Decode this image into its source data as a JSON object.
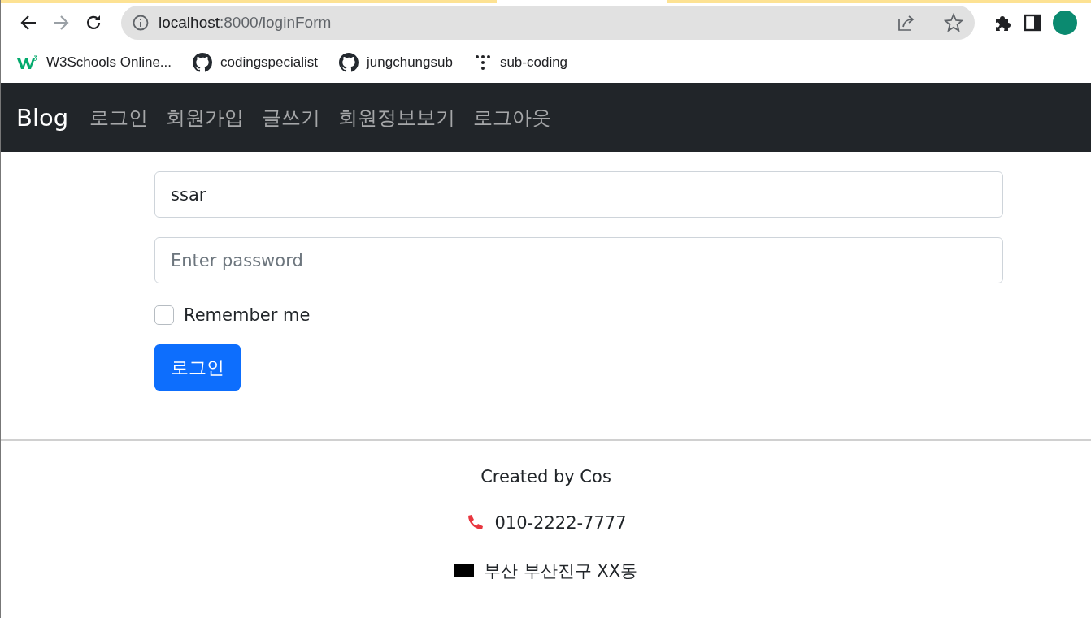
{
  "browser": {
    "url_host": "localhost",
    "url_path": ":8000/loginForm",
    "bookmarks": [
      {
        "kind": "w3",
        "label": "W3Schools Online..."
      },
      {
        "kind": "github",
        "label": "codingspecialist"
      },
      {
        "kind": "github",
        "label": "jungchungsub"
      },
      {
        "kind": "dots",
        "label": "sub-coding"
      }
    ]
  },
  "navbar": {
    "brand": "Blog",
    "links": [
      "로그인",
      "회원가입",
      "글쓰기",
      "회원정보보기",
      "로그아웃"
    ]
  },
  "form": {
    "username": {
      "value": "ssar"
    },
    "password": {
      "placeholder": "Enter password"
    },
    "remember": {
      "label": "Remember me",
      "checked": false
    },
    "submit": "로그인"
  },
  "footer": {
    "credit": "Created by Cos",
    "phone": "010-2222-7777",
    "address": "부산 부산진구 XX동"
  }
}
